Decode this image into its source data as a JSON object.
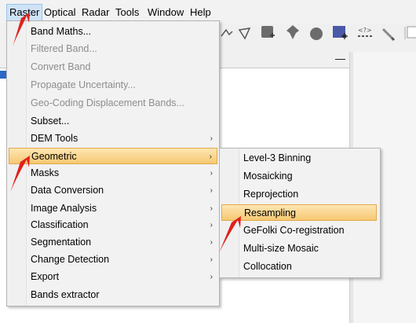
{
  "menubar": {
    "items": [
      {
        "label": "Raster"
      },
      {
        "label": "Optical"
      },
      {
        "label": "Radar"
      },
      {
        "label": "Tools"
      },
      {
        "label": "Window"
      },
      {
        "label": "Help"
      }
    ]
  },
  "raster_menu": {
    "items": [
      {
        "label": "Band Maths...",
        "enabled": true
      },
      {
        "label": "Filtered Band...",
        "enabled": false
      },
      {
        "label": "Convert Band",
        "enabled": false
      },
      {
        "label": "Propagate Uncertainty...",
        "enabled": false
      },
      {
        "label": "Geo-Coding Displacement Bands...",
        "enabled": false
      },
      {
        "label": "Subset...",
        "enabled": true
      },
      {
        "label": "DEM Tools",
        "enabled": true,
        "submenu": true
      },
      {
        "label": "Geometric",
        "enabled": true,
        "submenu": true,
        "highlighted": true
      },
      {
        "label": "Masks",
        "enabled": true,
        "submenu": true
      },
      {
        "label": "Data Conversion",
        "enabled": true,
        "submenu": true
      },
      {
        "label": "Image Analysis",
        "enabled": true,
        "submenu": true
      },
      {
        "label": "Classification",
        "enabled": true,
        "submenu": true
      },
      {
        "label": "Segmentation",
        "enabled": true,
        "submenu": true
      },
      {
        "label": "Change Detection",
        "enabled": true,
        "submenu": true
      },
      {
        "label": "Export",
        "enabled": true,
        "submenu": true
      },
      {
        "label": "Bands extractor",
        "enabled": true
      }
    ]
  },
  "geometric_menu": {
    "items": [
      {
        "label": "Level-3 Binning"
      },
      {
        "label": "Mosaicking"
      },
      {
        "label": "Reprojection"
      },
      {
        "label": "Resampling",
        "highlighted": true
      },
      {
        "label": "GeFolki Co-registration"
      },
      {
        "label": "Multi-size Mosaic"
      },
      {
        "label": "Collocation"
      }
    ]
  },
  "glyphs": {
    "submenu_arrow": "›",
    "minimize": "—"
  },
  "colors": {
    "highlight_top": "#fde6b3",
    "highlight_bottom": "#f7c872",
    "annotation_arrow": "#e0201a",
    "disabled_text": "#8d8d8d"
  }
}
